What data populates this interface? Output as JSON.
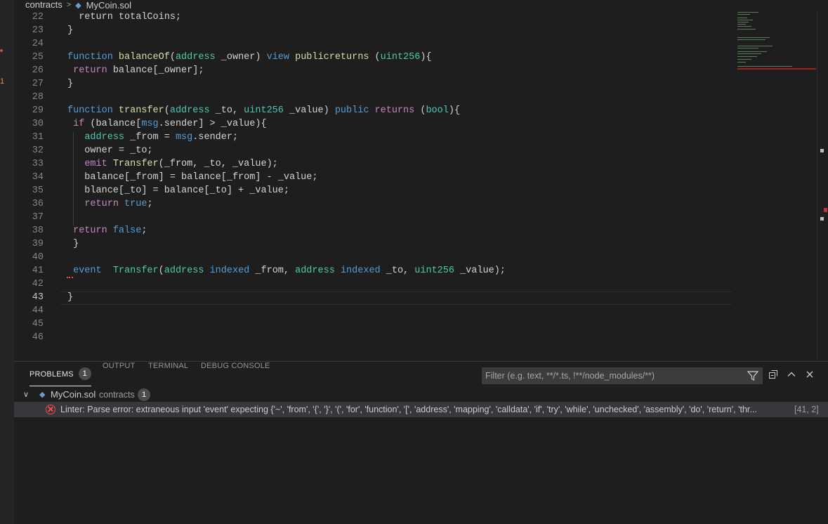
{
  "breadcrumb": {
    "folder": "contracts",
    "file": "MyCoin.sol",
    "chevron": ">"
  },
  "activity": {
    "badge": "1"
  },
  "editor": {
    "active_line": "43",
    "lines": [
      {
        "n": "22",
        "tokens": [
          [
            "",
            "  return totalCoins;"
          ]
        ]
      },
      {
        "n": "23",
        "tokens": [
          [
            "",
            "}"
          ]
        ]
      },
      {
        "n": "24",
        "tokens": []
      },
      {
        "n": "25",
        "tokens": [
          [
            "t-kw",
            "function"
          ],
          [
            "",
            " "
          ],
          [
            "t-fn",
            "balanceOf"
          ],
          [
            "",
            "("
          ],
          [
            "t-ty",
            "address"
          ],
          [
            "",
            " _owner) "
          ],
          [
            "t-kw",
            "view"
          ],
          [
            "",
            " "
          ],
          [
            "t-fn",
            "publicreturns"
          ],
          [
            "",
            " ("
          ],
          [
            "t-ty",
            "uint256"
          ],
          [
            "",
            "){"
          ]
        ]
      },
      {
        "n": "26",
        "tokens": [
          [
            "",
            " "
          ],
          [
            "t-kw2",
            "return"
          ],
          [
            "",
            " balance[_owner];"
          ]
        ]
      },
      {
        "n": "27",
        "tokens": [
          [
            "",
            "}"
          ]
        ]
      },
      {
        "n": "28",
        "tokens": []
      },
      {
        "n": "29",
        "tokens": [
          [
            "t-kw",
            "function"
          ],
          [
            "",
            " "
          ],
          [
            "t-fn",
            "transfer"
          ],
          [
            "",
            "("
          ],
          [
            "t-ty",
            "address"
          ],
          [
            "",
            " _to, "
          ],
          [
            "t-ty",
            "uint256"
          ],
          [
            "",
            " _value) "
          ],
          [
            "t-kw",
            "public"
          ],
          [
            "",
            " "
          ],
          [
            "t-kw2",
            "returns"
          ],
          [
            "",
            " ("
          ],
          [
            "t-ty",
            "bool"
          ],
          [
            "",
            "){"
          ]
        ]
      },
      {
        "n": "30",
        "tokens": [
          [
            "",
            " "
          ],
          [
            "t-kw2",
            "if"
          ],
          [
            "",
            " (balance["
          ],
          [
            "t-kw",
            "msg"
          ],
          [
            "",
            ".sender] > _value){"
          ]
        ]
      },
      {
        "n": "31",
        "tokens": [
          [
            "",
            "   "
          ],
          [
            "t-ty",
            "address"
          ],
          [
            "",
            " _from = "
          ],
          [
            "t-kw",
            "msg"
          ],
          [
            "",
            ".sender;"
          ]
        ]
      },
      {
        "n": "32",
        "tokens": [
          [
            "",
            "   owner = _to;"
          ]
        ]
      },
      {
        "n": "33",
        "tokens": [
          [
            "",
            "   "
          ],
          [
            "t-kw2",
            "emit"
          ],
          [
            "",
            " "
          ],
          [
            "t-fn",
            "Transfer"
          ],
          [
            "",
            "(_from, _to, _value);"
          ]
        ]
      },
      {
        "n": "34",
        "tokens": [
          [
            "",
            "   balance[_from] = balance[_from] - _value;"
          ]
        ]
      },
      {
        "n": "35",
        "tokens": [
          [
            "",
            "   blance[_to] = balance[_to] + _value;"
          ]
        ]
      },
      {
        "n": "36",
        "tokens": [
          [
            "",
            "   "
          ],
          [
            "t-kw2",
            "return"
          ],
          [
            "",
            " "
          ],
          [
            "t-kw",
            "true"
          ],
          [
            "",
            ";"
          ]
        ]
      },
      {
        "n": "37",
        "tokens": []
      },
      {
        "n": "38",
        "tokens": [
          [
            "",
            " "
          ],
          [
            "t-kw2",
            "return"
          ],
          [
            "",
            " "
          ],
          [
            "t-kw",
            "false"
          ],
          [
            "",
            ";"
          ]
        ]
      },
      {
        "n": "39",
        "tokens": [
          [
            "",
            " }"
          ]
        ]
      },
      {
        "n": "40",
        "tokens": []
      },
      {
        "n": "41",
        "tokens": [
          [
            "",
            " "
          ],
          [
            "t-kw",
            "event"
          ],
          [
            "",
            "  "
          ],
          [
            "t-ty",
            "Transfer"
          ],
          [
            "",
            "("
          ],
          [
            "t-ty",
            "address"
          ],
          [
            "",
            " "
          ],
          [
            "t-kw",
            "indexed"
          ],
          [
            "",
            " _from, "
          ],
          [
            "t-ty",
            "address"
          ],
          [
            "",
            " "
          ],
          [
            "t-kw",
            "indexed"
          ],
          [
            "",
            " _to, "
          ],
          [
            "t-ty",
            "uint256"
          ],
          [
            "",
            " _value);"
          ]
        ]
      },
      {
        "n": "42",
        "tokens": []
      },
      {
        "n": "43",
        "tokens": [
          [
            "",
            "}"
          ]
        ]
      },
      {
        "n": "44",
        "tokens": []
      },
      {
        "n": "45",
        "tokens": []
      },
      {
        "n": "46",
        "tokens": []
      }
    ]
  },
  "panel": {
    "tabs": [
      {
        "label": "PROBLEMS",
        "badge": "1",
        "active": true
      },
      {
        "label": "OUTPUT"
      },
      {
        "label": "TERMINAL"
      },
      {
        "label": "DEBUG CONSOLE"
      }
    ],
    "filter_placeholder": "Filter (e.g. text, **/*.ts, !**/node_modules/**)",
    "file_group": {
      "file": "MyCoin.sol",
      "folder": "contracts",
      "count": "1"
    },
    "problem": {
      "message": "Linter: Parse error: extraneous input 'event' expecting {'~', 'from', '{', '}', '(', 'for', 'function', '[', 'address', 'mapping', 'calldata', 'if', 'try', 'while', 'unchecked', 'assembly', 'do', 'return', 'thr...",
      "location": "[41, 2]"
    }
  },
  "colors": {
    "error": "#f14c4c",
    "keyword": "#569cd6",
    "control": "#c586c0",
    "function": "#dcdcaa",
    "type": "#4ec9b0"
  }
}
